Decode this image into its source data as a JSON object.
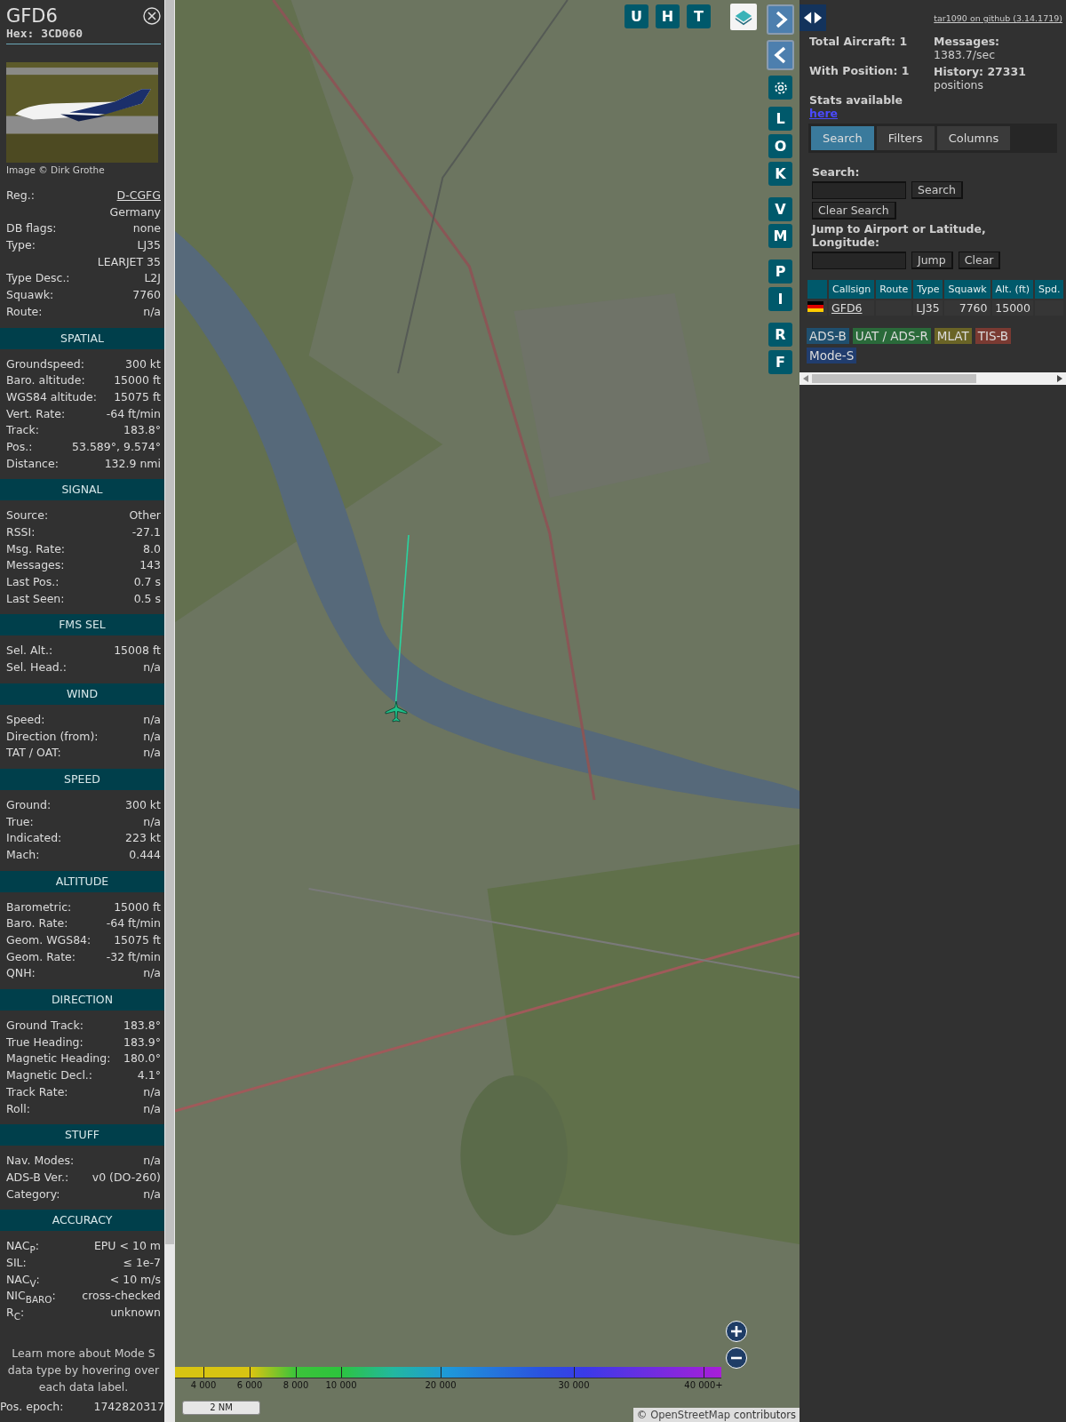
{
  "aircraft_panel": {
    "callsign": "GFD6",
    "hex": "Hex: 3CD060",
    "photo": {
      "kind": "picture"
    },
    "photo_credit": "Image © Dirk Grothe",
    "sections": [
      {
        "rows": [
          {
            "label": "Reg.:",
            "value": "D-CGFG",
            "kind": "link"
          },
          {
            "value": "Germany"
          },
          {
            "label": "DB flags:",
            "value": "none"
          },
          {
            "label": "Type:",
            "value": "LJ35"
          },
          {
            "value": "LEARJET 35"
          },
          {
            "label": "Type Desc.:",
            "value": "L2J"
          },
          {
            "label": "Squawk:",
            "value": "7760"
          },
          {
            "label": "Route:",
            "value": "n/a"
          }
        ]
      },
      {
        "title": "SPATIAL",
        "rows": [
          {
            "label": "Groundspeed:",
            "value": "300 kt"
          },
          {
            "label": "Baro. altitude:",
            "value": "15000 ft"
          },
          {
            "label": "WGS84 altitude:",
            "value": "15075 ft"
          },
          {
            "label": "Vert. Rate:",
            "value": "-64 ft/min"
          },
          {
            "label": "Track:",
            "value": "183.8°"
          },
          {
            "label": "Pos.:",
            "value": "53.589°, 9.574°"
          },
          {
            "label": "Distance:",
            "value": "132.9 nmi"
          }
        ]
      },
      {
        "title": "SIGNAL",
        "rows": [
          {
            "label": "Source:",
            "value": "Other"
          },
          {
            "label": "RSSI:",
            "value": "-27.1"
          },
          {
            "label": "Msg. Rate:",
            "value": "8.0"
          },
          {
            "label": "Messages:",
            "value": "143"
          },
          {
            "label": "Last Pos.:",
            "value": "0.7 s"
          },
          {
            "label": "Last Seen:",
            "value": "0.5 s"
          }
        ]
      },
      {
        "title": "FMS SEL",
        "rows": [
          {
            "label": "Sel. Alt.:",
            "value": "15008 ft"
          },
          {
            "label": "Sel. Head.:",
            "value": "n/a"
          }
        ]
      },
      {
        "title": "WIND",
        "rows": [
          {
            "label": "Speed:",
            "value": "n/a"
          },
          {
            "label": "Direction (from):",
            "value": "n/a"
          },
          {
            "label": "TAT / OAT:",
            "value": "n/a"
          }
        ]
      },
      {
        "title": "SPEED",
        "rows": [
          {
            "label": "Ground:",
            "value": "300 kt"
          },
          {
            "label": "True:",
            "value": "n/a"
          },
          {
            "label": "Indicated:",
            "value": "223 kt"
          },
          {
            "label": "Mach:",
            "value": "0.444"
          }
        ]
      },
      {
        "title": "ALTITUDE",
        "rows": [
          {
            "label": "Barometric:",
            "value": "15000 ft"
          },
          {
            "label": "Baro. Rate:",
            "value": "-64 ft/min"
          },
          {
            "label": "Geom. WGS84:",
            "value": "15075 ft"
          },
          {
            "label": "Geom. Rate:",
            "value": "-32 ft/min"
          },
          {
            "label": "QNH:",
            "value": "n/a"
          }
        ]
      },
      {
        "title": "DIRECTION",
        "rows": [
          {
            "label": "Ground Track:",
            "value": "183.8°"
          },
          {
            "label": "True Heading:",
            "value": "183.9°"
          },
          {
            "label": "Magnetic Heading:",
            "value": "180.0°"
          },
          {
            "label": "Magnetic Decl.:",
            "value": "4.1°"
          },
          {
            "label": "Track Rate:",
            "value": "n/a"
          },
          {
            "label": "Roll:",
            "value": "n/a"
          }
        ]
      },
      {
        "title": "STUFF",
        "rows": [
          {
            "label": "Nav. Modes:",
            "value": "n/a"
          },
          {
            "label": "ADS-B Ver.:",
            "value": "v0 (DO-260)"
          },
          {
            "label": "Category:",
            "value": "n/a"
          }
        ]
      },
      {
        "title": "ACCURACY",
        "rows": [
          {
            "label": "NAC$_{P}$:",
            "value": "EPU < 10 m"
          },
          {
            "label": "SIL:",
            "value": "≤ 1e-7"
          },
          {
            "label": "NAC$_{V}$:",
            "value": "< 10 m/s"
          },
          {
            "label": "NIC$_{BARO}$:",
            "value": "cross-checked"
          },
          {
            "label": "R$_{C}$:",
            "value": "unknown"
          }
        ]
      }
    ],
    "note": "Learn more about Mode S data type by hovering over each data label.",
    "epoch": {
      "label": "Pos. epoch:",
      "value": "1742820317"
    }
  },
  "map": {
    "picture": {
      "kind": "picture"
    },
    "top_buttons": [
      "U",
      "H",
      "T"
    ],
    "side_buttons": [
      "L",
      "O",
      "K",
      "V",
      "M",
      "P",
      "I",
      "R",
      "F"
    ],
    "altitude_scale": [
      "4 000",
      "6 000",
      "8 000",
      "10 000",
      "20 000",
      "30 000",
      "40 000+"
    ],
    "scale_line": "2 NM",
    "attribution": {
      "prefix": "©",
      "link": "OpenStreetMap",
      "suffix": "contributors"
    }
  },
  "side_panel": {
    "version_link": "tar1090 on github (3.14.1719)",
    "stats": {
      "total": "Total Aircraft: 1",
      "with_position": "With Position: 1",
      "messages_label": "Messages:",
      "messages_value": "1383.7/sec",
      "history_label": "History: 27331",
      "history_value": "positions",
      "stats_text": "Stats available",
      "stats_link": "here"
    },
    "tabs": [
      {
        "label": "Search",
        "selected": true
      },
      {
        "label": "Filters",
        "selected": false
      },
      {
        "label": "Columns",
        "selected": false
      }
    ],
    "search": {
      "label": "Search:",
      "search_button": "Search",
      "clear_search_button": "Clear Search",
      "jump_label": "Jump to Airport or Latitude, Longitude:",
      "jump_button": "Jump",
      "clear_button": "Clear"
    },
    "table": {
      "columns": [
        "Callsign",
        "Route",
        "Type",
        "Squawk",
        "Alt. (ft)",
        "Spd."
      ],
      "rows": [
        {
          "callsign": "GFD6",
          "type": "LJ35",
          "squawk": "7760",
          "altitude": "15000"
        }
      ]
    },
    "sources": [
      {
        "label": "ADS-B",
        "color": "#1f4f6e"
      },
      {
        "label": "UAT / ADS-R",
        "color": "#2a6a3a"
      },
      {
        "label": "MLAT",
        "color": "#6a6426"
      },
      {
        "label": "TIS-B",
        "color": "#7a3a32"
      },
      {
        "label": "Mode-S",
        "color": "#213d6e"
      }
    ]
  }
}
